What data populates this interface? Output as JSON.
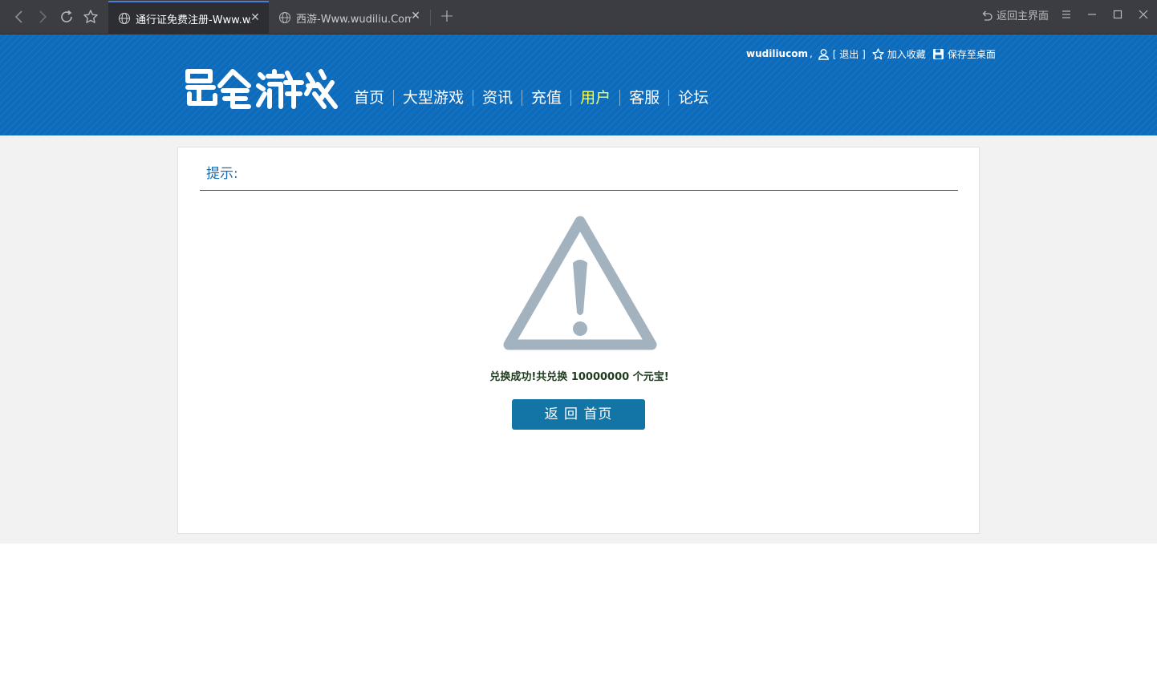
{
  "browser": {
    "tabs": [
      {
        "title": "通行证免费注册-Www.w...",
        "active": true
      },
      {
        "title": "西游-Www.wudiliu.Com",
        "active": false
      }
    ],
    "home_return_label": "返回主界面",
    "icons": {
      "back": "back-arrow-icon",
      "forward": "forward-arrow-icon",
      "reload": "reload-icon",
      "favorite": "star-icon",
      "tab": "globe-icon",
      "menu": "menu-icon",
      "minimize": "minimize-icon",
      "maximize": "maximize-icon",
      "close": "close-icon"
    }
  },
  "header": {
    "top_links": {
      "username": "wudiliucom",
      "logout": "[ 退出 ]",
      "favorite": "加入收藏",
      "save_desktop": "保存至桌面"
    },
    "nav": [
      "首页",
      "大型游戏",
      "资讯",
      "充值",
      "用户",
      "客服",
      "论坛"
    ],
    "current_nav": "用户",
    "colors": {
      "header_bg": "#0d6bbc",
      "current_nav": "#f6ff5c"
    }
  },
  "notice": {
    "title": "提示:",
    "message": "兑换成功!共兑换 10000000 个元宝!",
    "back_button": "返 回 首页",
    "icon": "warning-triangle-icon",
    "colors": {
      "icon": "#a3b2bf",
      "button": "#1374a6",
      "title": "#1b6cb0"
    }
  }
}
